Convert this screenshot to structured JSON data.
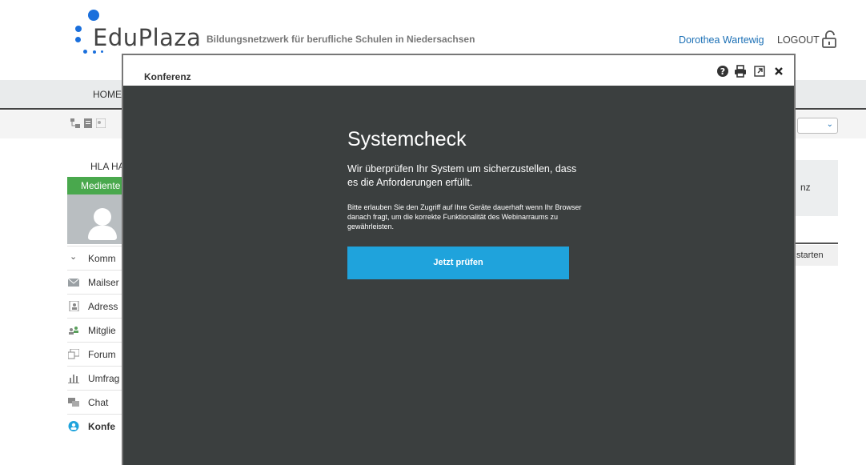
{
  "brand": {
    "name": "EduPlaza",
    "tagline": "Bildungsnetzwerk für berufliche Schulen in Niedersachsen",
    "colors": {
      "dot_blue": "#1a6fdc",
      "accent": "#1fa3dc",
      "green": "#49a84d"
    }
  },
  "header": {
    "user_name": "Dorothea Wartewig",
    "logout_label": "LOGOUT",
    "lock_icon": "unlock-icon"
  },
  "nav": {
    "home_label": "HOME"
  },
  "sidebar": {
    "group_label": "HLA HA",
    "green_label": "Mediente",
    "section_label": "Komm",
    "items": [
      {
        "label": "Mailser",
        "icon": "mail-icon"
      },
      {
        "label": "Adress",
        "icon": "address-book-icon"
      },
      {
        "label": "Mitglie",
        "icon": "members-icon"
      },
      {
        "label": "Forum",
        "icon": "forum-icon"
      },
      {
        "label": "Umfrag",
        "icon": "survey-icon"
      },
      {
        "label": "Chat",
        "icon": "chat-icon"
      },
      {
        "label": "Konfe",
        "icon": "conference-icon"
      }
    ]
  },
  "right": {
    "panel_text": "nz",
    "start_text": "starten"
  },
  "modal": {
    "title": "Konferenz",
    "icons": [
      "help-icon",
      "print-icon",
      "popout-icon",
      "close-icon"
    ],
    "systemcheck": {
      "heading": "Systemcheck",
      "lead": "Wir überprüfen Ihr System um sicherzustellen, dass es die Anforderungen erfüllt.",
      "note": "Bitte erlauben Sie den Zugriff auf Ihre Geräte dauerhaft wenn Ihr Browser danach fragt, um die korrekte Funktionalität des Webinarraums zu gewährleisten.",
      "button_label": "Jetzt prüfen"
    }
  }
}
